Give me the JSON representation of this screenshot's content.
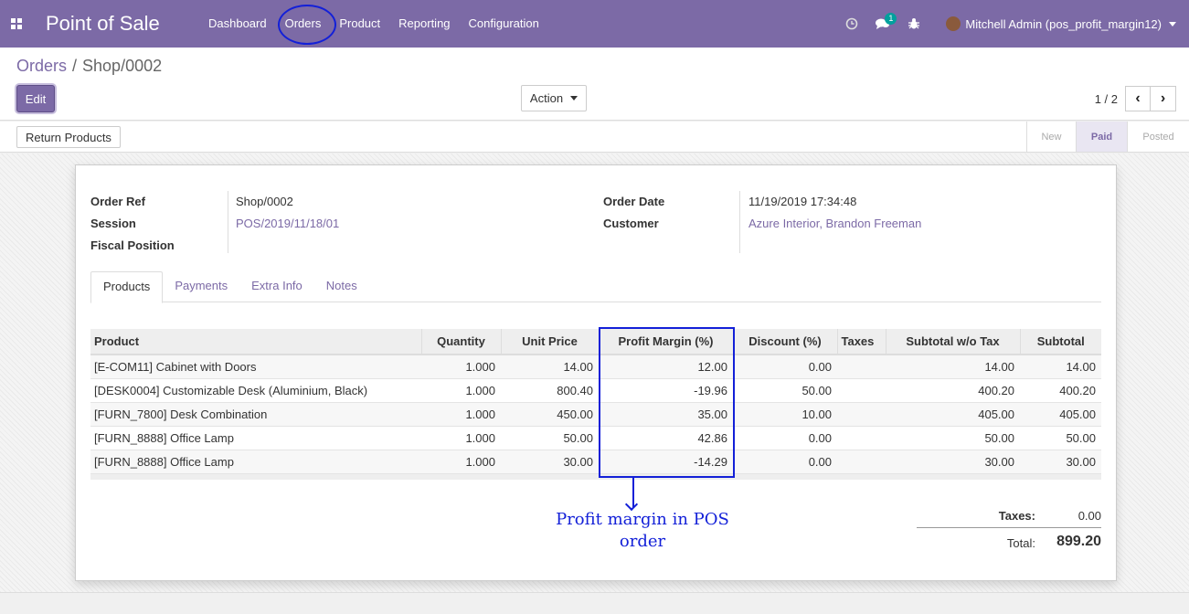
{
  "navbar": {
    "brand": "Point of Sale",
    "menu": [
      "Dashboard",
      "Orders",
      "Product",
      "Reporting",
      "Configuration"
    ],
    "messages_badge": "1",
    "user": "Mitchell Admin (pos_profit_margin12)",
    "accent": "#7c6aa6"
  },
  "control_panel": {
    "breadcrumb_parent": "Orders",
    "breadcrumb_current": "Shop/0002",
    "edit_label": "Edit",
    "action_label": "Action",
    "pager_value": "1 / 2"
  },
  "statusbar": {
    "return_label": "Return Products",
    "stages": [
      "New",
      "Paid",
      "Posted"
    ],
    "active_stage": "Paid"
  },
  "form": {
    "order_ref_label": "Order Ref",
    "order_ref": "Shop/0002",
    "session_label": "Session",
    "session": "POS/2019/11/18/01",
    "fiscal_label": "Fiscal Position",
    "order_date_label": "Order Date",
    "order_date": "11/19/2019 17:34:48",
    "customer_label": "Customer",
    "customer": "Azure Interior, Brandon Freeman"
  },
  "tabs": [
    "Products",
    "Payments",
    "Extra Info",
    "Notes"
  ],
  "lines": {
    "headers": [
      "Product",
      "Quantity",
      "Unit Price",
      "Profit Margin (%)",
      "Discount (%)",
      "Taxes",
      "Subtotal w/o Tax",
      "Subtotal"
    ],
    "rows": [
      [
        "[E-COM11] Cabinet with Doors",
        "1.000",
        "14.00",
        "12.00",
        "0.00",
        "",
        "14.00",
        "14.00"
      ],
      [
        "[DESK0004] Customizable Desk (Aluminium, Black)",
        "1.000",
        "800.40",
        "-19.96",
        "50.00",
        "",
        "400.20",
        "400.20"
      ],
      [
        "[FURN_7800] Desk Combination",
        "1.000",
        "450.00",
        "35.00",
        "10.00",
        "",
        "405.00",
        "405.00"
      ],
      [
        "[FURN_8888] Office Lamp",
        "1.000",
        "50.00",
        "42.86",
        "0.00",
        "",
        "50.00",
        "50.00"
      ],
      [
        "[FURN_8888] Office Lamp",
        "1.000",
        "30.00",
        "-14.29",
        "0.00",
        "",
        "30.00",
        "30.00"
      ]
    ]
  },
  "annotation": {
    "line1": "Profit margin in POS",
    "line2": "order",
    "color": "#1320d8"
  },
  "totals": {
    "taxes_label": "Taxes:",
    "taxes": "0.00",
    "total_label": "Total:",
    "total": "899.20"
  }
}
